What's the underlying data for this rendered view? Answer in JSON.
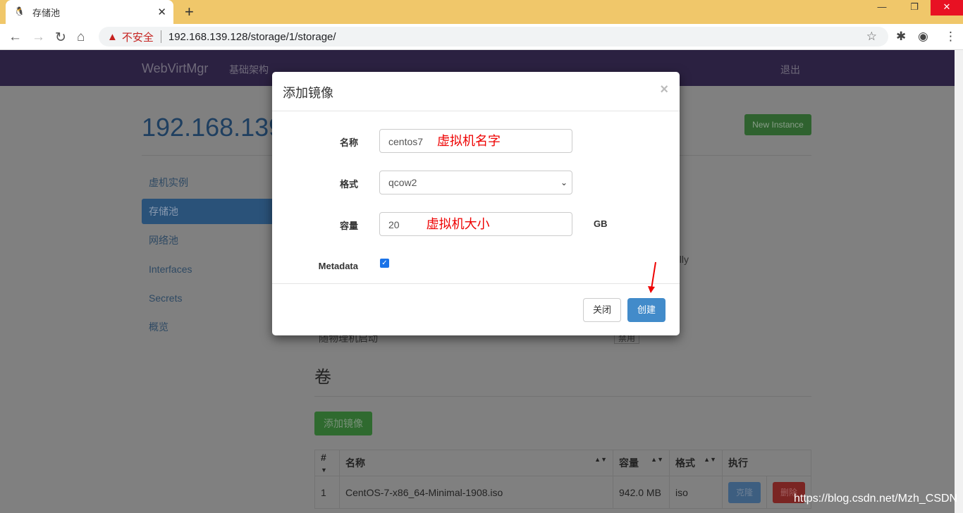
{
  "browser": {
    "tab_title": "存储池",
    "url": "192.168.139.128/storage/1/storage/",
    "security_label": "不安全"
  },
  "navbar": {
    "brand": "WebVirtMgr",
    "link": "基础架构",
    "logout": "退出"
  },
  "page": {
    "title": "192.168.139",
    "new_instance": "New Instance",
    "sidebar": [
      {
        "label": "虚机实例"
      },
      {
        "label": "存储池",
        "active": true
      },
      {
        "label": "网络池"
      },
      {
        "label": "Interfaces"
      },
      {
        "label": "Secrets"
      },
      {
        "label": "概览"
      }
    ],
    "bg_partial_text": "ally",
    "autostart_label": "随物理机启动",
    "autostart_button": "禁用",
    "volumes_heading": "卷",
    "add_image_button": "添加镜像",
    "table": {
      "headers": [
        "#",
        "名称",
        "容量",
        "格式",
        "执行"
      ],
      "rows": [
        {
          "num": "1",
          "name": "CentOS-7-x86_64-Minimal-1908.iso",
          "size": "942.0 MB",
          "format": "iso",
          "clone": "克隆",
          "delete": "删除"
        }
      ]
    }
  },
  "modal": {
    "title": "添加镜像",
    "name_label": "名称",
    "name_value": "centos7",
    "name_annotation": "虚拟机名字",
    "format_label": "格式",
    "format_value": "qcow2",
    "size_label": "容量",
    "size_value": "20",
    "size_annotation": "虚拟机大小",
    "size_unit": "GB",
    "metadata_label": "Metadata",
    "metadata_checked": true,
    "close_button": "关闭",
    "create_button": "创建"
  },
  "watermark": "https://blog.csdn.net/Mzh_CSDN",
  "colors": {
    "annotation": "#ee0000",
    "primary": "#428bca",
    "navbar": "#2b2141"
  }
}
